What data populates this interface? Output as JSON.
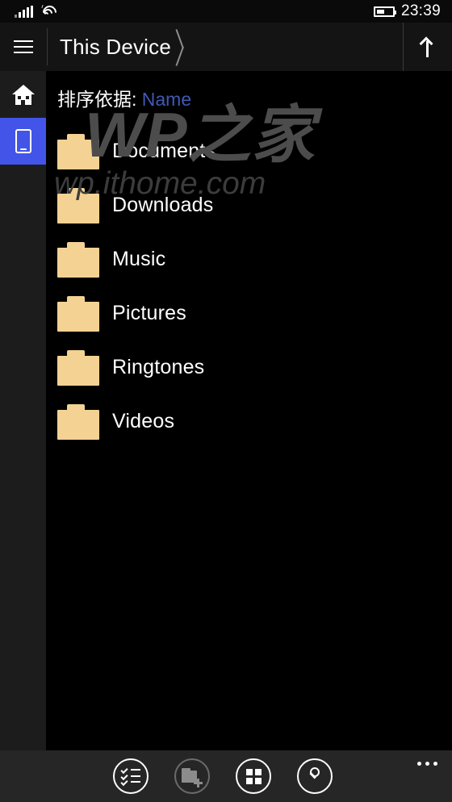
{
  "status_bar": {
    "signal_icon": "cellular-signal-icon",
    "signal_bars": 5,
    "wifi_icon": "wifi-icon",
    "battery_icon": "battery-icon",
    "battery_level_percent": 40,
    "time": "23:39"
  },
  "title_bar": {
    "menu_icon": "hamburger-menu-icon",
    "breadcrumb": "This Device",
    "breadcrumb_separator_icon": "chevron-right-icon",
    "up_icon": "arrow-up-icon"
  },
  "rail": {
    "items": [
      {
        "label": "Home",
        "icon": "home-icon",
        "selected": false
      },
      {
        "label": "This Device",
        "icon": "phone-icon",
        "selected": true
      }
    ],
    "selected_color": "#4255e8"
  },
  "content": {
    "sort_label": "排序依据: ",
    "sort_value": "Name",
    "sort_accent_color": "#3f59b5",
    "folder_color": "#f3d293",
    "items": [
      {
        "name": "Documents",
        "icon": "folder-icon"
      },
      {
        "name": "Downloads",
        "icon": "folder-icon"
      },
      {
        "name": "Music",
        "icon": "folder-icon"
      },
      {
        "name": "Pictures",
        "icon": "folder-icon"
      },
      {
        "name": "Ringtones",
        "icon": "folder-icon"
      },
      {
        "name": "Videos",
        "icon": "folder-icon"
      }
    ]
  },
  "watermark": {
    "main": "WP之家",
    "sub": "wp.ithome.com"
  },
  "app_bar": {
    "buttons": [
      {
        "name": "select",
        "icon": "checklist-icon",
        "enabled": true
      },
      {
        "name": "new-folder",
        "icon": "new-folder-icon",
        "enabled": false
      },
      {
        "name": "view-grid",
        "icon": "grid-view-icon",
        "enabled": true
      },
      {
        "name": "search",
        "icon": "search-icon",
        "enabled": true
      }
    ],
    "more_icon": "ellipsis-icon"
  }
}
